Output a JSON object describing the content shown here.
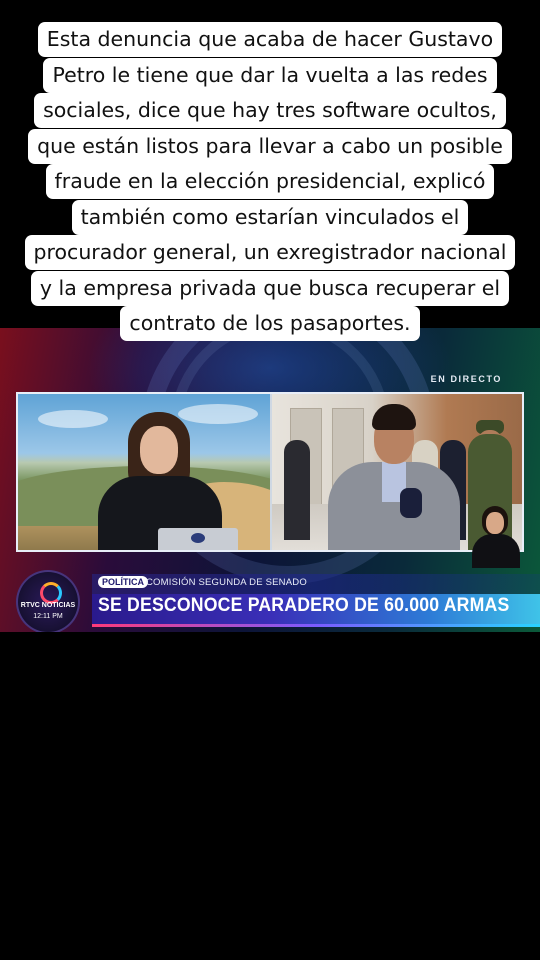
{
  "caption": {
    "lines": [
      "Esta denuncia que acaba de hacer Gustavo",
      "Petro le tiene que dar la vuelta a las redes",
      "sociales, dice que hay tres software ocultos,",
      "que están listos para llevar a cabo un posible",
      "fraude en la elección presidencial, explicó",
      "también como estarían vinculados el",
      "procurador general, un exregistrador nacional",
      "y la empresa privada que busca recuperar el",
      "contrato de los pasaportes."
    ]
  },
  "broadcast": {
    "live_label": "EN DIRECTO",
    "channel": {
      "name": "RTVC NOTICIAS",
      "time": "12:11 PM"
    },
    "lower_third": {
      "section": "POLÍTICA",
      "subtitle": "COMISIÓN SEGUNDA DE SENADO",
      "headline": "SE DESCONOCE PARADERO DE 60.000 ARMAS"
    }
  },
  "colors": {
    "caption_bg": "#ffffff",
    "headline_bar": "#3a2fb8",
    "headline_bar_end": "#3fc3e8",
    "accent_line": "#ff3a7a"
  }
}
